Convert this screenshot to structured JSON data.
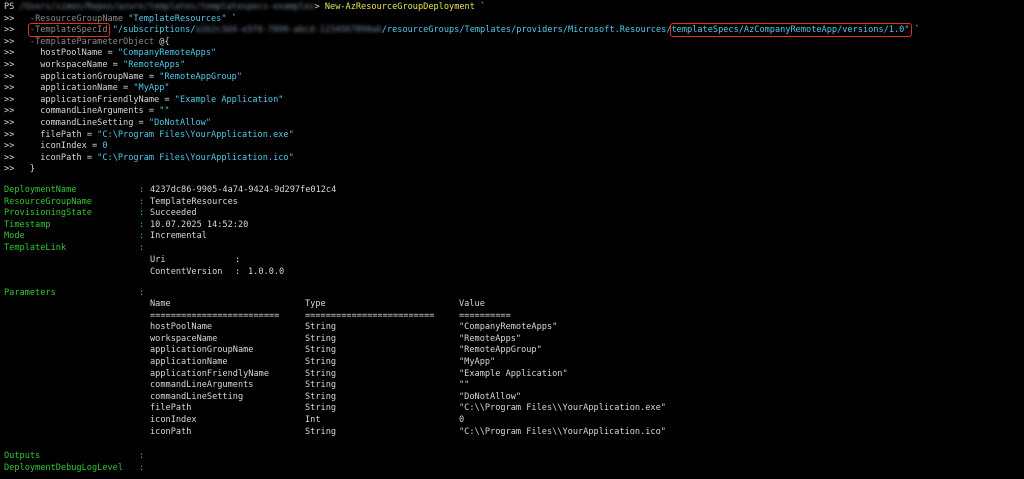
{
  "prompt": {
    "ps": "PS",
    "path": "/Users/simon/Repos/azure/templates/templatespecs-examples",
    "gt": ">",
    "command": "New-AzResourceGroupDeployment",
    "cont": "`",
    "chevron": ">>"
  },
  "cmd": {
    "rg_param": "-ResourceGroupName",
    "rg_value": "\"TemplateResources\"",
    "tsid_param": "-TemplateSpecId",
    "tsid_value_start": "\"/subscriptions/",
    "tsid_redacted": "a1b2c3d4-e5f6-7890-abcd-1234567890ab",
    "tsid_value_mid": "/resourceGroups/Templates/providers/Microsoft.Resources/",
    "tsid_value_hl": "templateSpecs/AzCompanyRemoteApp/versions/1.0\"",
    "tpo_param": "-TemplateParameterObject",
    "tpo_open": "@{",
    "close": "}",
    "params": [
      {
        "key": "hostPoolName",
        "eq": " = ",
        "val": "\"CompanyRemoteApps\""
      },
      {
        "key": "workspaceName",
        "eq": " = ",
        "val": "\"RemoteApps\""
      },
      {
        "key": "applicationGroupName",
        "eq": " = ",
        "val": "\"RemoteAppGroup\""
      },
      {
        "key": "applicationName",
        "eq": " = ",
        "val": "\"MyApp\""
      },
      {
        "key": "applicationFriendlyName",
        "eq": " = ",
        "val": "\"Example Application\""
      },
      {
        "key": "commandLineArguments",
        "eq": " = ",
        "val": "\"\""
      },
      {
        "key": "commandLineSetting",
        "eq": " = ",
        "val": "\"DoNotAllow\""
      },
      {
        "key": "filePath",
        "eq": " = ",
        "val": "\"C:\\Program Files\\YourApplication.exe\""
      },
      {
        "key": "iconIndex",
        "eq": " = ",
        "val": "0"
      },
      {
        "key": "iconPath",
        "eq": " = ",
        "val": "\"C:\\Program Files\\YourApplication.ico\""
      }
    ]
  },
  "output": {
    "colon": ":",
    "deployment_name": {
      "label": "DeploymentName",
      "value": "4237dc86-9905-4a74-9424-9d297fe012c4"
    },
    "resource_group": {
      "label": "ResourceGroupName",
      "value": "TemplateResources"
    },
    "provisioning_state": {
      "label": "ProvisioningState",
      "value": "Succeeded"
    },
    "timestamp": {
      "label": "Timestamp",
      "value": "10.07.2025 14:52:20"
    },
    "mode": {
      "label": "Mode",
      "value": "Incremental"
    },
    "template_link": {
      "label": "TemplateLink",
      "uri_label": "Uri",
      "uri_value": "",
      "version_label": "ContentVersion",
      "version_value": "1.0.0.0"
    },
    "parameters_label": "Parameters",
    "table": {
      "headers": [
        "Name",
        "Type",
        "Value"
      ],
      "separators": [
        "=========================",
        "=========================",
        "=========="
      ],
      "rows": [
        [
          "hostPoolName",
          "String",
          "\"CompanyRemoteApps\""
        ],
        [
          "workspaceName",
          "String",
          "\"RemoteApps\""
        ],
        [
          "applicationGroupName",
          "String",
          "\"RemoteAppGroup\""
        ],
        [
          "applicationName",
          "String",
          "\"MyApp\""
        ],
        [
          "applicationFriendlyName",
          "String",
          "\"Example Application\""
        ],
        [
          "commandLineArguments",
          "String",
          "\"\""
        ],
        [
          "commandLineSetting",
          "String",
          "\"DoNotAllow\""
        ],
        [
          "filePath",
          "String",
          "\"C:\\\\Program Files\\\\YourApplication.exe\""
        ],
        [
          "iconIndex",
          "Int",
          "0"
        ],
        [
          "iconPath",
          "String",
          "\"C:\\\\Program Files\\\\YourApplication.ico\""
        ]
      ]
    },
    "outputs_label": "Outputs",
    "debug_label": "DeploymentDebugLogLevel"
  },
  "colors": {
    "background": "#000000",
    "green": "#32c832",
    "cyan": "#54c9e8",
    "yellow": "#e6e652",
    "gray": "#8a8a8a",
    "highlight": "#e0301e"
  }
}
